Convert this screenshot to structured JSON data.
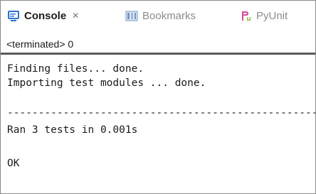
{
  "tabs": [
    {
      "label": "Console",
      "icon": "console-icon",
      "active": true,
      "closable": true
    },
    {
      "label": "Bookmarks",
      "icon": "bookmarks-icon",
      "active": false
    },
    {
      "label": "PyUnit",
      "icon": "pyunit-icon",
      "active": false
    }
  ],
  "status": "<terminated> 0",
  "console": {
    "lines": [
      "Finding files... done.",
      "Importing test modules ... done.",
      "",
      "----------------------------------------------------------------------",
      "Ran 3 tests in 0.001s",
      "",
      "OK"
    ]
  },
  "colors": {
    "console_icon": "#2f6fd0",
    "pyunit_icon": "#d94a9a",
    "separator": "#5a5a5a",
    "frame_border": "#8a8a8a"
  }
}
